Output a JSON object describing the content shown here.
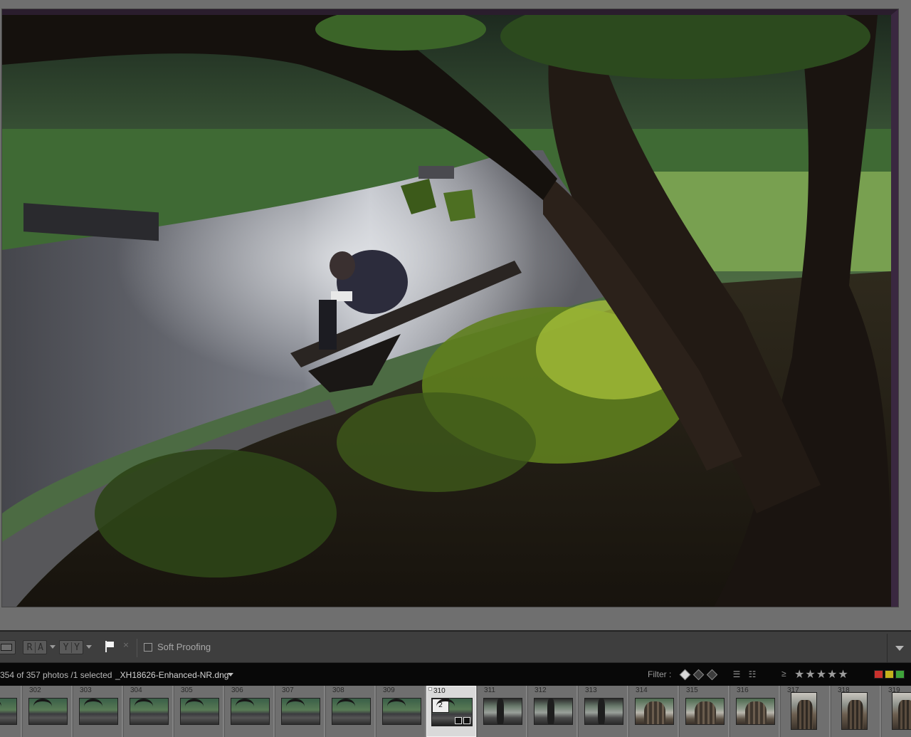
{
  "toolbar": {
    "view_loupe": "loupe-view",
    "compare_ra": [
      "R",
      "A"
    ],
    "compare_yy": [
      "Y",
      "Y"
    ],
    "reject_glyph": "×",
    "soft_proofing_label": "Soft Proofing",
    "soft_proofing_checked": false
  },
  "filmstrip_header": {
    "count_text": "354 of 357 photos /1 selected",
    "filename": "_XH18626-Enhanced-NR.dng",
    "filter_label": "Filter :",
    "rating_operator": "≥",
    "stars": "★★★★★",
    "color_labels": [
      "#c8312d",
      "#c4b21c",
      "#3ea33a"
    ]
  },
  "filmstrip": {
    "selected_stack_count": "2",
    "cells": [
      {
        "num": "",
        "kind": "land"
      },
      {
        "num": "302",
        "kind": "land"
      },
      {
        "num": "303",
        "kind": "land"
      },
      {
        "num": "304",
        "kind": "land"
      },
      {
        "num": "305",
        "kind": "land"
      },
      {
        "num": "306",
        "kind": "land"
      },
      {
        "num": "307",
        "kind": "land"
      },
      {
        "num": "308",
        "kind": "land"
      },
      {
        "num": "309",
        "kind": "land"
      },
      {
        "num": "310",
        "kind": "sel"
      },
      {
        "num": "311",
        "kind": "land2"
      },
      {
        "num": "312",
        "kind": "land2"
      },
      {
        "num": "313",
        "kind": "land2"
      },
      {
        "num": "314",
        "kind": "land3"
      },
      {
        "num": "315",
        "kind": "land3"
      },
      {
        "num": "316",
        "kind": "land3"
      },
      {
        "num": "317",
        "kind": "port"
      },
      {
        "num": "318",
        "kind": "port"
      },
      {
        "num": "319",
        "kind": "port"
      }
    ]
  },
  "colors": {
    "panel_bg": "#3e3e3e",
    "header_bg": "#080808",
    "filmstrip_bg": "#7c7c7c",
    "photo_border": "#3a2840"
  }
}
